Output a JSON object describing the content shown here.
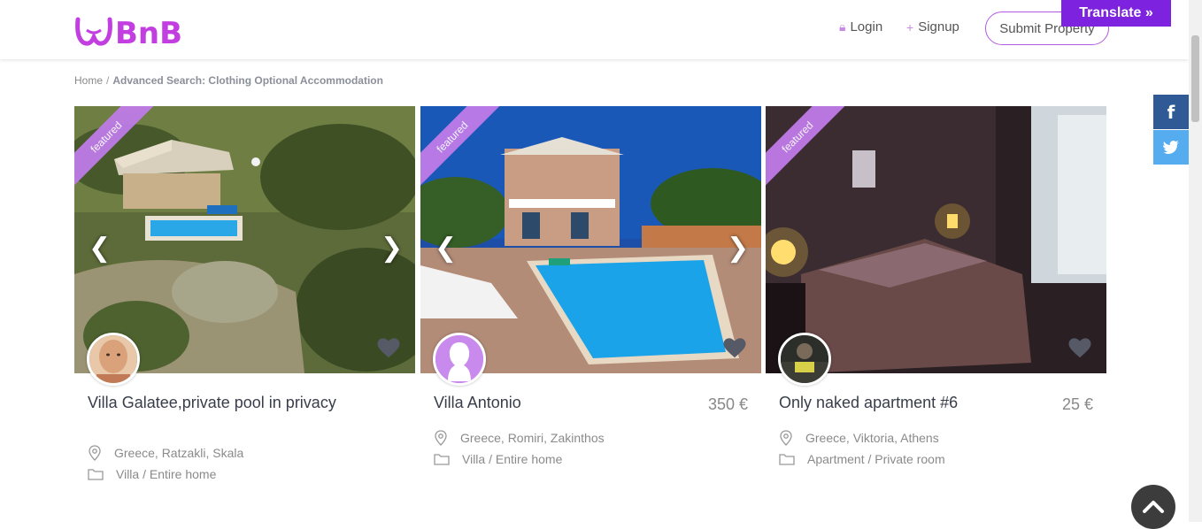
{
  "header": {
    "logo_text": "ωBnB",
    "login_label": "Login",
    "signup_label": "Signup",
    "submit_label": "Submit Property",
    "translate_label": "Translate »",
    "brand_color": "#c23ee0"
  },
  "breadcrumb": {
    "home": "Home",
    "separator": "/",
    "current": "Advanced Search: Clothing Optional Accommodation"
  },
  "share": {
    "facebook": "f",
    "twitter": "t"
  },
  "listings": [
    {
      "badge": "featured",
      "title": "Villa Galatee,private pool in privacy",
      "price": "",
      "location": "Greece, Ratzakli, Skala",
      "category": "Villa / Entire home"
    },
    {
      "badge": "featured",
      "title": "Villa Antonio",
      "price": "350 €",
      "location": "Greece, Romiri, Zakinthos",
      "category": "Villa / Entire home"
    },
    {
      "badge": "featured",
      "title": "Only naked apartment #6",
      "price": "25 €",
      "location": "Greece, Viktoria, Athens",
      "category": "Apartment / Private room"
    }
  ]
}
